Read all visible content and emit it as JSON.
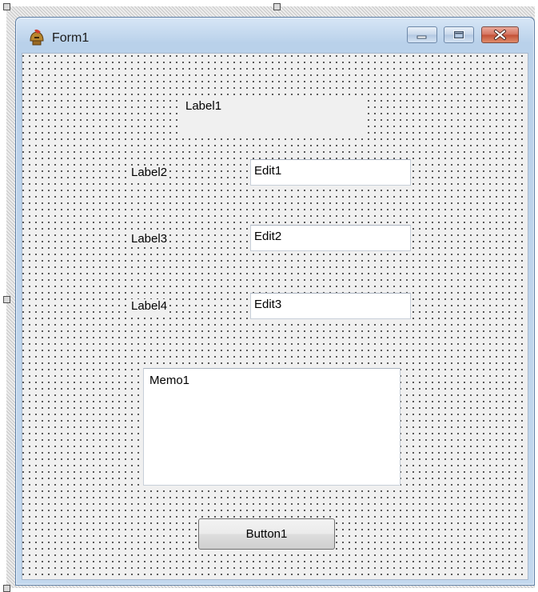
{
  "window": {
    "title": "Form1",
    "app_icon": "delphi-helmet-icon",
    "controls": [
      "minimize-icon",
      "maximize-icon",
      "close-icon"
    ]
  },
  "form": {
    "label1": "Label1",
    "label2": "Label2",
    "label3": "Label3",
    "label4": "Label4",
    "edit1": "Edit1",
    "edit2": "Edit2",
    "edit3": "Edit3",
    "memo1": "Memo1",
    "button1": "Button1"
  },
  "colors": {
    "client_background": "#f0f0f0",
    "grid_dot": "#2e2e2e",
    "titlebar": "#c3d8ee",
    "close_button": "#c24f35"
  }
}
